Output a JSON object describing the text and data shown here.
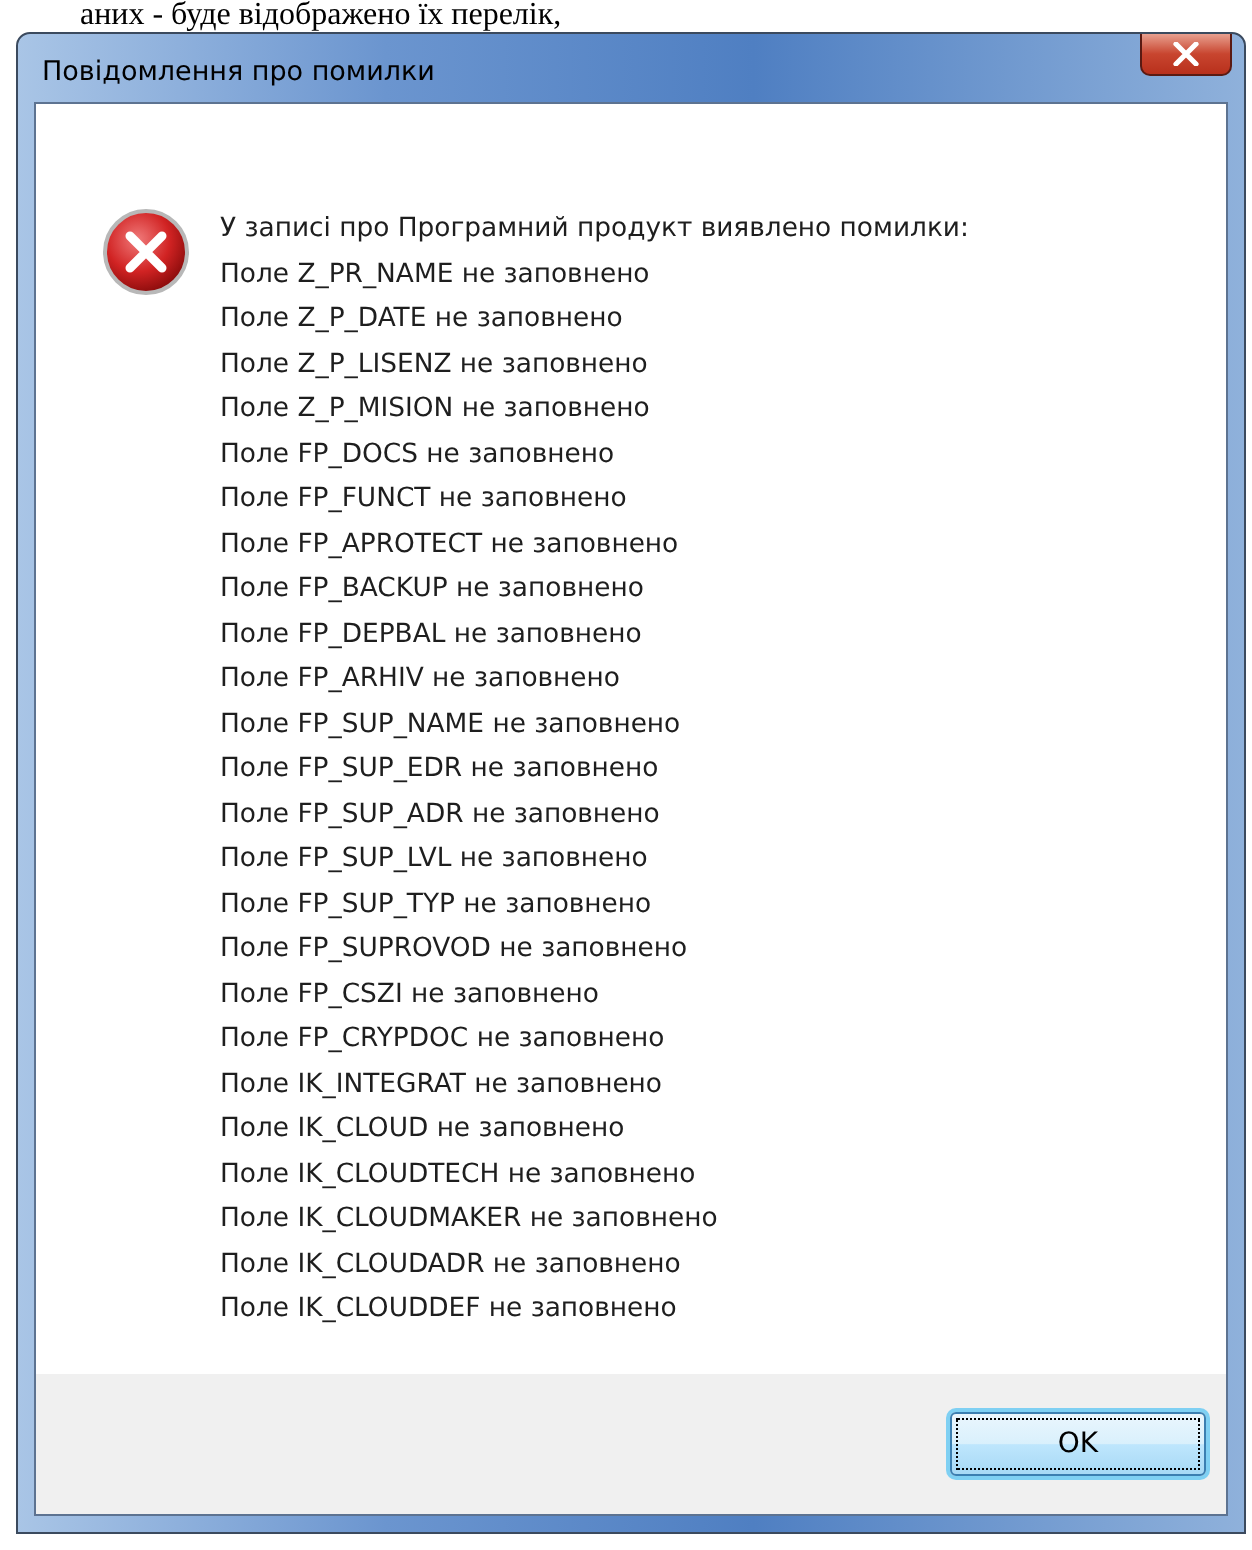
{
  "document_text": "аних - буде відображено їх перелік,",
  "window": {
    "title": "Повідомлення про помилки"
  },
  "message": {
    "heading": "У записі про Програмний продукт виявлено помилки:",
    "lines": [
      "Поле Z_PR_NAME не заповнено",
      "Поле Z_P_DATE не заповнено",
      "Поле Z_P_LISENZ не заповнено",
      "Поле Z_P_MISION не заповнено",
      "Поле FP_DOCS не заповнено",
      "Поле FP_FUNCT не заповнено",
      "Поле FP_APROTECT не заповнено",
      "Поле FP_BACKUP не заповнено",
      "Поле FP_DEPBAL не заповнено",
      "Поле FP_ARHIV не заповнено",
      "Поле FP_SUP_NAME не заповнено",
      "Поле FP_SUP_EDR не заповнено",
      "Поле FP_SUP_ADR не заповнено",
      "Поле FP_SUP_LVL не заповнено",
      "Поле FP_SUP_TYP не заповнено",
      "Поле FP_SUPROVOD не заповнено",
      "Поле FP_CSZI не заповнено",
      "Поле FP_CRYPDOC не заповнено",
      "Поле IK_INTEGRAT не заповнено",
      "Поле IK_CLOUD не заповнено",
      "Поле IK_CLOUDTECH не заповнено",
      "Поле IK_CLOUDMAKER не заповнено",
      "Поле IK_CLOUDADR не заповнено",
      "Поле IK_CLOUDDEF не заповнено"
    ]
  },
  "buttons": [
    {
      "label": "OK",
      "focused": true
    }
  ]
}
